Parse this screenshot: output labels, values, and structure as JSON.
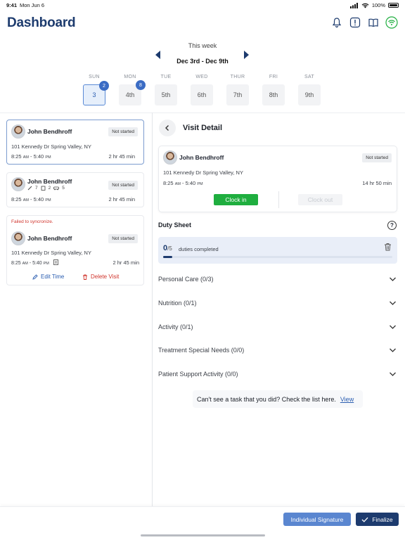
{
  "status_bar": {
    "time": "9:41",
    "date": "Mon Jun 6",
    "battery": "100%"
  },
  "header": {
    "title": "Dashboard"
  },
  "week": {
    "label": "This week",
    "range": "Dec 3rd -  Dec 9th",
    "days": [
      {
        "name": "SUN",
        "date": "3",
        "badge": "2",
        "active": true
      },
      {
        "name": "MON",
        "date": "4th",
        "badge": "8",
        "active": false
      },
      {
        "name": "TUE",
        "date": "5th",
        "badge": "",
        "active": false
      },
      {
        "name": "WED",
        "date": "6th",
        "badge": "",
        "active": false
      },
      {
        "name": "THUR",
        "date": "7th",
        "badge": "",
        "active": false
      },
      {
        "name": "FRI",
        "date": "8th",
        "badge": "",
        "active": false
      },
      {
        "name": "SAT",
        "date": "9th",
        "badge": "",
        "active": false
      }
    ]
  },
  "visits": [
    {
      "name": "John Bendhroff",
      "status": "Not started",
      "address": "101 Kennedy Dr Spring Valley, NY",
      "time_start": "8:25",
      "time_start_ampm": "AM",
      "time_end": "5:40",
      "time_end_ampm": "PM",
      "duration": "2 hr 45 min"
    },
    {
      "name": "John Bendhroff",
      "status": "Not started",
      "icon_counts": [
        "7",
        "2",
        "5"
      ],
      "time_start": "8:25",
      "time_start_ampm": "AM",
      "time_end": "5:40",
      "time_end_ampm": "PM",
      "duration": "2 hr 45 min"
    },
    {
      "sync_error": "Failed to syncronize.",
      "name": "John Bendhroff",
      "status": "Not started",
      "address": "101 Kennedy Dr Spring Valley, NY",
      "time_start": "8:25",
      "time_start_ampm": "AM",
      "time_end": "5:40",
      "time_end_ampm": "PM",
      "duration": "2 hr 45 min",
      "edit_label": "Edit Time",
      "delete_label": "Delete Visit"
    }
  ],
  "detail": {
    "title": "Visit Detail",
    "name": "John Bendhroff",
    "status": "Not started",
    "address": "101 Kennedy Dr Spring Valley, NY",
    "time_start": "8:25",
    "time_start_ampm": "AM",
    "time_end": "5:40",
    "time_end_ampm": "PM",
    "duration": "14 hr 50 min",
    "clock_in": "Clock in",
    "clock_out": "Clock out"
  },
  "duty_sheet": {
    "title": "Duty Sheet",
    "completed": "0",
    "total": "/5",
    "completed_label": "duties completed",
    "progress_fraction": 0.04,
    "sections": [
      "Personal Care (0/3)",
      "Nutrition (0/1)",
      "Activity (0/1)",
      "Treatment Special Needs (0/0)",
      "Patient Support Activity (0/0)"
    ]
  },
  "hint": {
    "text": "Can't see a task that you did? Check the list here.",
    "link": "View"
  },
  "footer": {
    "signature_label": "Individual Signature",
    "finalize_label": "Finalize"
  },
  "colors": {
    "brand": "#1d3b6e",
    "accent": "#3b6cc4",
    "success": "#1fae3f",
    "error": "#d0342c"
  }
}
